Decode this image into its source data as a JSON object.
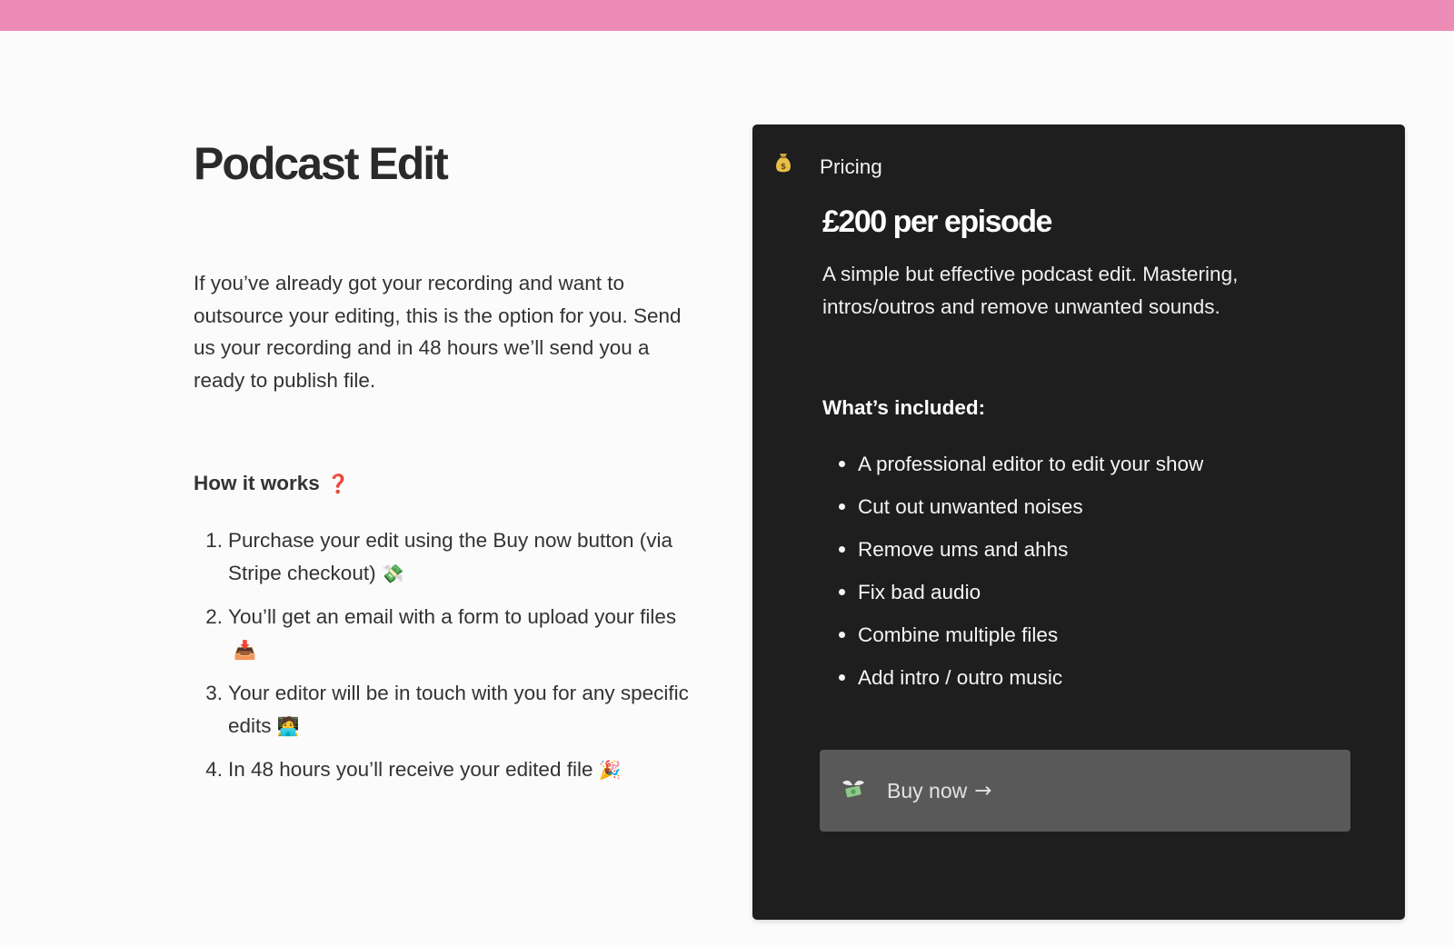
{
  "colors": {
    "top_bar": "#ed8bb7",
    "card_bg": "#1e1e1e",
    "button_bg": "#595959",
    "question_mark": "#e0454f"
  },
  "left": {
    "title": "Podcast Edit",
    "intro": "If you’ve already got your recording and want to outsource your editing, this is the option for you. Send us your recording and in 48 hours we’ll send you a ready to publish file.",
    "how_title": "How it works",
    "how_icon": "❓",
    "steps": [
      {
        "num": "1.",
        "text": "Purchase your edit using the Buy now button (via Stripe checkout)",
        "emoji": "💸",
        "icon_name": "money-with-wings-icon"
      },
      {
        "num": "2.",
        "text": "You’ll get an email with a form to upload your files",
        "emoji": "📥",
        "icon_name": "inbox-tray-icon"
      },
      {
        "num": "3.",
        "text": "Your editor will be in touch with you for any specific edits",
        "emoji": "🧑‍💻",
        "icon_name": "technologist-icon"
      },
      {
        "num": "4.",
        "text": "In 48 hours you’ll receive your edited file",
        "emoji": "🎉",
        "icon_name": "party-popper-icon"
      }
    ]
  },
  "card": {
    "icon": "money-bag-icon",
    "label": "Pricing",
    "price": "£200 per episode",
    "description": "A simple but effective podcast edit. Mastering, intros/outros and remove unwanted sounds.",
    "included_title": "What’s included:",
    "features": [
      "A professional editor to edit your show",
      "Cut out unwanted noises",
      "Remove ums and ahhs",
      "Fix bad audio",
      "Combine multiple files",
      "Add intro / outro music"
    ],
    "button": {
      "icon": "money-with-wings-icon",
      "label": "Buy now",
      "arrow": "→"
    }
  }
}
